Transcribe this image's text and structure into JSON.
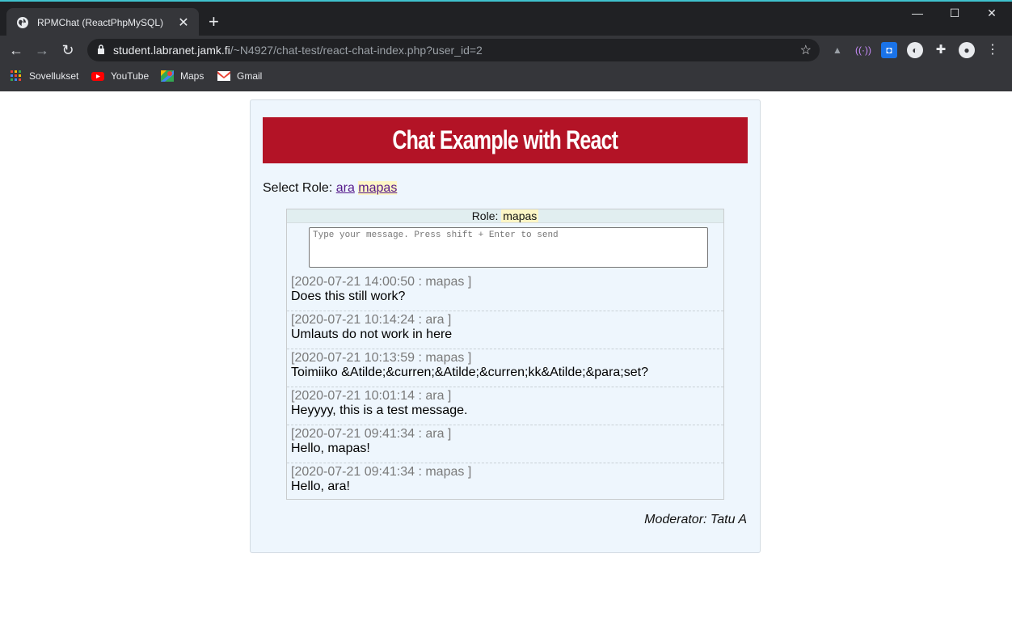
{
  "browser": {
    "tab_title": "RPMChat (ReactPhpMySQL)",
    "url_host": "student.labranet.jamk.fi",
    "url_path": "/~N4927/chat-test/react-chat-index.php?user_id=2",
    "bookmarks": [
      {
        "label": "Sovellukset",
        "icon": "apps-grid-icon"
      },
      {
        "label": "YouTube",
        "icon": "youtube-icon"
      },
      {
        "label": "Maps",
        "icon": "maps-icon"
      },
      {
        "label": "Gmail",
        "icon": "gmail-icon"
      }
    ]
  },
  "page": {
    "banner_title": "Chat Example with React",
    "select_role_label": "Select Role:",
    "roles": [
      "ara",
      "mapas"
    ],
    "active_role": "mapas",
    "chat_role_label": "Role:",
    "chat_role_value": "mapas",
    "input_placeholder": "Type your message. Press shift + Enter to send",
    "messages": [
      {
        "meta": "[2020-07-21 14:00:50 : mapas ]",
        "text": "Does this still work?"
      },
      {
        "meta": "[2020-07-21 10:14:24 : ara ]",
        "text": "Umlauts do not work in here"
      },
      {
        "meta": "[2020-07-21 10:13:59 : mapas ]",
        "text": "Toimiiko &Atilde;&curren;&Atilde;&curren;kk&Atilde;&para;set?"
      },
      {
        "meta": "[2020-07-21 10:01:14 : ara ]",
        "text": "Heyyyy, this is a test message."
      },
      {
        "meta": "[2020-07-21 09:41:34 : ara ]",
        "text": "Hello, mapas!"
      },
      {
        "meta": "[2020-07-21 09:41:34 : mapas ]",
        "text": "Hello, ara!"
      }
    ],
    "moderator": "Moderator: Tatu A"
  },
  "colors": {
    "banner_bg": "#b31326",
    "container_bg": "#eef6fd",
    "highlight": "#fdf6c5",
    "link": "#551a8b"
  }
}
